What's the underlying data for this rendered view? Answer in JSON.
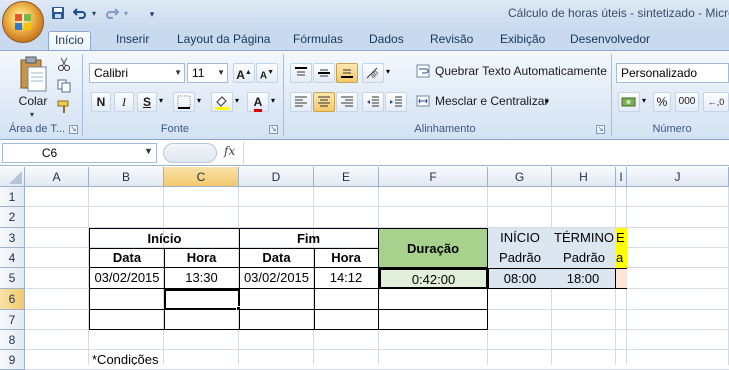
{
  "window": {
    "title": "Cálculo de horas úteis - sintetizado - Micro"
  },
  "qat": {
    "save_icon": "save-icon",
    "undo_icon": "undo-icon",
    "redo_icon": "redo-icon",
    "customize_icon": "chevron-down-icon"
  },
  "tabs": [
    "Início",
    "Inserir",
    "Layout da Página",
    "Fórmulas",
    "Dados",
    "Revisão",
    "Exibição",
    "Desenvolvedor"
  ],
  "ribbon": {
    "clipboard": {
      "paste_label": "Colar",
      "group_label": "Área de T..."
    },
    "font": {
      "name": "Calibri",
      "size": "11",
      "group_label": "Fonte"
    },
    "alignment": {
      "wrap_label": "Quebrar Texto Automaticamente",
      "merge_label": "Mesclar e Centralizar",
      "group_label": "Alinhamento"
    },
    "number": {
      "format": "Personalizado",
      "group_label": "Número"
    }
  },
  "formula_bar": {
    "name_box": "C6",
    "fx": "fx",
    "content": ""
  },
  "columns": [
    "A",
    "B",
    "C",
    "D",
    "E",
    "F",
    "G",
    "H",
    "I",
    "J"
  ],
  "rows": [
    "1",
    "2",
    "3",
    "4",
    "5",
    "6",
    "7",
    "8",
    "9"
  ],
  "cells": {
    "B3": "Início",
    "D3": "Fim",
    "F3": "Duração",
    "B4": "Data",
    "C4": "Hora",
    "D4": "Data",
    "E4": "Hora",
    "G3": "INÍCIO",
    "G4": "Padrão",
    "H3": "TÉRMINO",
    "H4": "Padrão",
    "I3": "E",
    "I4": "a",
    "B5": "03/02/2015",
    "C5": "13:30",
    "D5": "03/02/2015",
    "E5": "14:12",
    "F5": "0:42:00",
    "G5": "08:00",
    "H5": "18:00",
    "B9": "*Condições"
  },
  "colors": {
    "duration_header": "#a9d18e",
    "duration_value": "#e2efda",
    "standard_fill": "#dce6f1",
    "yellow_fill": "#ffff00",
    "orange_fill": "#fce4d6"
  }
}
